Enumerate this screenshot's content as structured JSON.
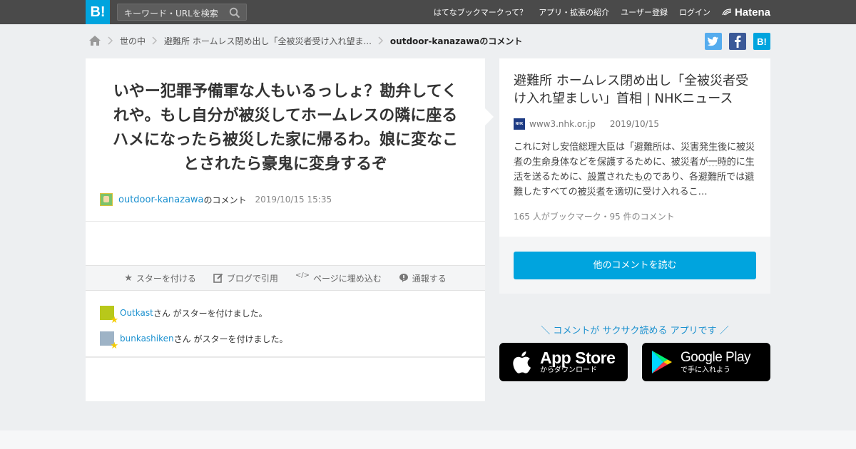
{
  "header": {
    "logo": "B!",
    "search_placeholder": "キーワード・URLを検索",
    "nav": [
      "はてなブックマークって？",
      "アプリ・拡張の紹介",
      "ユーザー登録",
      "ログイン"
    ],
    "brand": "Hatena"
  },
  "breadcrumb": {
    "items": [
      "世の中",
      "避難所 ホームレス閉め出し「全被災者受け入れ望ま..."
    ],
    "current": "outdoor-kanazawaのコメント"
  },
  "share": {
    "twitter_icon": "t",
    "facebook_icon": "f",
    "hatebu_icon": "B!"
  },
  "comment": {
    "text": "いやー犯罪予備軍な人もいるっしょ？勘弁してくれや。もし自分が被災してホームレスの隣に座るハメになったら被災した家に帰るわ。娘に変なことされたら豪鬼に変身するぞ",
    "user": "outdoor-kanazawa",
    "user_suffix": "のコメント",
    "datetime": "2019/10/15 15:35"
  },
  "actions": {
    "star": "スターを付ける",
    "blog": "ブログで引用",
    "embed": "ページに埋め込む",
    "report": "通報する"
  },
  "stars": [
    {
      "user": "Outkast",
      "text": "さん がスターを付けました。"
    },
    {
      "user": "bunkashiken",
      "text": "さん がスターを付けました。"
    }
  ],
  "entry": {
    "title": "避難所 ホームレス閉め出し「全被災者受け入れ望ましい」首相 | NHKニュース",
    "favicon": "NHK",
    "domain": "www3.nhk.or.jp",
    "date": "2019/10/15",
    "summary_parts": [
      [
        "これに対し",
        false
      ],
      [
        "安倍総理大臣",
        true
      ],
      [
        "は「",
        false
      ],
      [
        "避難所",
        true
      ],
      [
        "は、",
        false
      ],
      [
        "災害発生後",
        true
      ],
      [
        "に",
        false
      ],
      [
        "被災者",
        true
      ],
      [
        "の",
        false
      ],
      [
        "生命身体",
        true
      ],
      [
        "などを",
        false
      ],
      [
        "保護",
        true
      ],
      [
        "するために、",
        false
      ],
      [
        "被災者",
        true
      ],
      [
        "が",
        false
      ],
      [
        "一時的",
        true
      ],
      [
        "に",
        false
      ],
      [
        "生活",
        true
      ],
      [
        "を送るために、",
        false
      ],
      [
        "設置",
        true
      ],
      [
        "された",
        false
      ],
      [
        "もの",
        true
      ],
      [
        "であり、各",
        false
      ],
      [
        "避難所",
        true
      ],
      [
        "では",
        false
      ],
      [
        "避難",
        true
      ],
      [
        "したすべての",
        false
      ],
      [
        "被災者",
        true
      ],
      [
        "を適切に受け入れるこ…",
        false
      ]
    ],
    "stats": "165 人がブックマーク・95 件のコメント",
    "read_button": "他のコメントを読む"
  },
  "apps": {
    "promo": "＼ コメントが サクサク読める アプリです ／",
    "appstore_main": "App Store",
    "appstore_sub": "からダウンロード",
    "googleplay_main": "Google Play",
    "googleplay_sub": "で手に入れよう"
  },
  "colors": {
    "accent": "#00a4de",
    "link": "#1a90cf",
    "header_bg": "#4a4a4a",
    "twitter": "#55acee",
    "facebook": "#3b5998"
  }
}
